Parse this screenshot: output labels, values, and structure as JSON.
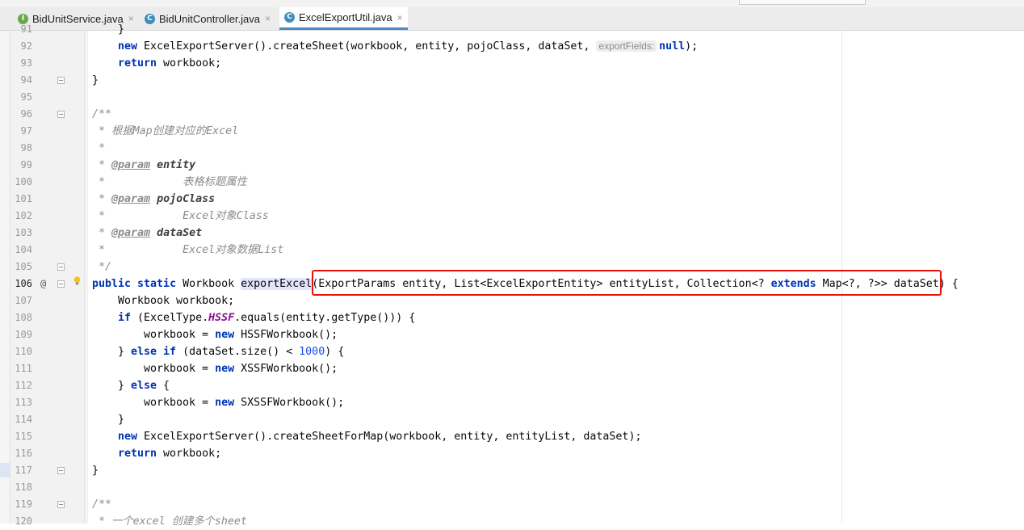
{
  "tabs": [
    {
      "label": "BidUnitService.java",
      "icon": "interface-icon",
      "icon_letter": "I",
      "active": false
    },
    {
      "label": "BidUnitController.java",
      "icon": "class-icon",
      "icon_letter": "C",
      "active": false
    },
    {
      "label": "ExcelExportUtil.java",
      "icon": "class-icon",
      "icon_letter": "C",
      "active": true
    }
  ],
  "tab_close_glyph": "×",
  "gutter": {
    "override_marker": "@"
  },
  "lines": [
    {
      "no": "91",
      "code": "}"
    },
    {
      "no": "92",
      "code": "new ExcelExportServer().createSheet(workbook, entity, pojoClass, dataSet, exportFields: null);",
      "hint": "exportFields:"
    },
    {
      "no": "93",
      "code": "return workbook;"
    },
    {
      "no": "94",
      "code": "}"
    },
    {
      "no": "95",
      "code": ""
    },
    {
      "no": "96",
      "code": "/**"
    },
    {
      "no": "97",
      "code": " * 根据Map创建对应的Excel"
    },
    {
      "no": "98",
      "code": " *"
    },
    {
      "no": "99",
      "code": " * @param entity"
    },
    {
      "no": "100",
      "code": " *            表格标题属性"
    },
    {
      "no": "101",
      "code": " * @param pojoClass"
    },
    {
      "no": "102",
      "code": " *            Excel对象Class"
    },
    {
      "no": "103",
      "code": " * @param dataSet"
    },
    {
      "no": "104",
      "code": " *            Excel对象数据List"
    },
    {
      "no": "105",
      "code": " */"
    },
    {
      "no": "106",
      "code": "public static Workbook exportExcel(ExportParams entity, List<ExcelExportEntity> entityList, Collection<? extends Map<?, ?>> dataSet) {"
    },
    {
      "no": "107",
      "code": "Workbook workbook;"
    },
    {
      "no": "108",
      "code": "if (ExcelType.HSSF.equals(entity.getType())) {"
    },
    {
      "no": "109",
      "code": "workbook = new HSSFWorkbook();"
    },
    {
      "no": "110",
      "code": "} else if (dataSet.size() < 1000) {"
    },
    {
      "no": "111",
      "code": "workbook = new XSSFWorkbook();"
    },
    {
      "no": "112",
      "code": "} else {"
    },
    {
      "no": "113",
      "code": "workbook = new SXSSFWorkbook();"
    },
    {
      "no": "114",
      "code": "}"
    },
    {
      "no": "115",
      "code": "new ExcelExportServer().createSheetForMap(workbook, entity, entityList, dataSet);"
    },
    {
      "no": "116",
      "code": "return workbook;"
    },
    {
      "no": "117",
      "code": "}"
    },
    {
      "no": "118",
      "code": ""
    },
    {
      "no": "119",
      "code": "/**"
    },
    {
      "no": "120",
      "code": " * 一个excel 创建多个sheet"
    }
  ],
  "colors": {
    "keyword": "#0033b3",
    "comment": "#8c8c8c",
    "number": "#1750eb",
    "static_field": "#871094",
    "highlight_box": "#e8140c",
    "active_tab_underline": "#4a88c7"
  }
}
